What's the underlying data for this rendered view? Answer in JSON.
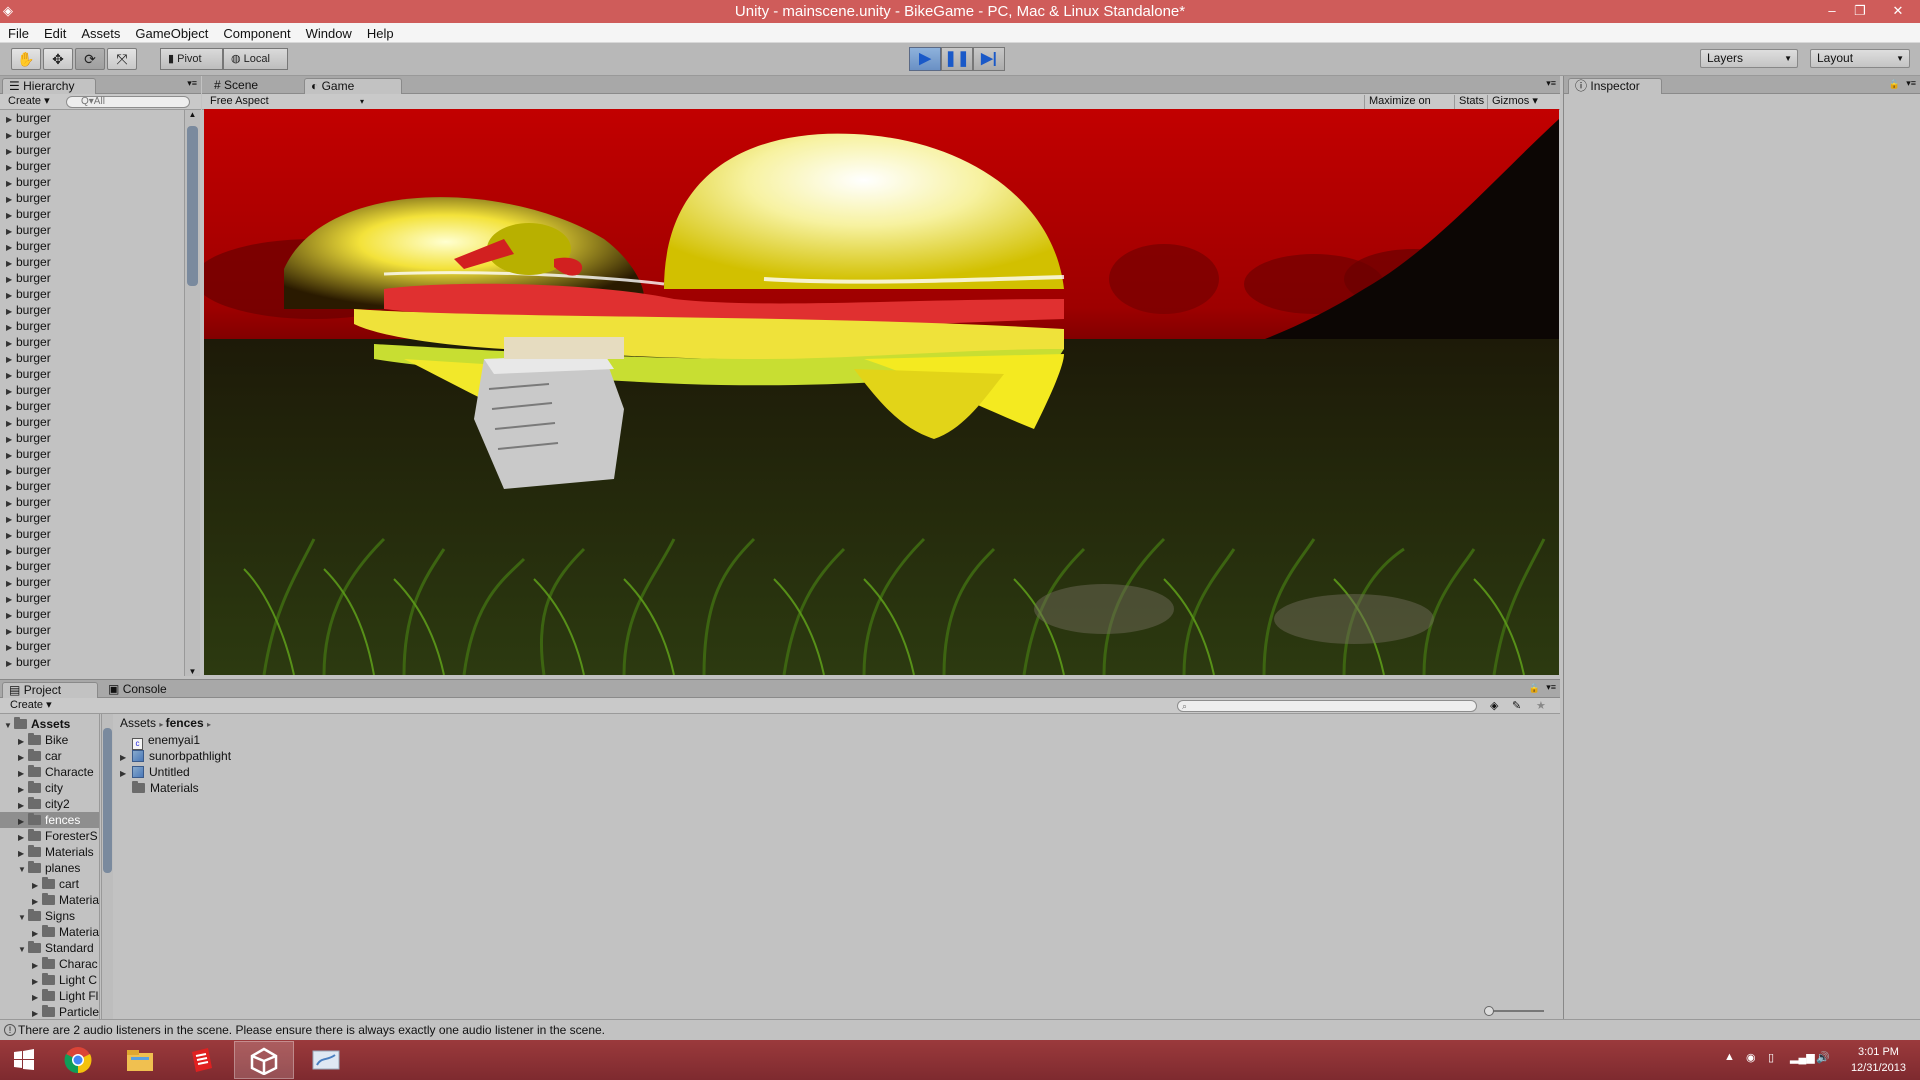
{
  "window": {
    "title": "Unity - mainscene.unity - BikeGame - PC, Mac & Linux Standalone*",
    "app_icon": "unity-icon",
    "controls": [
      "minimize",
      "restore",
      "close"
    ]
  },
  "menu": [
    "File",
    "Edit",
    "Assets",
    "GameObject",
    "Component",
    "Window",
    "Help"
  ],
  "toolbar": {
    "tools": [
      "hand-tool-icon",
      "move-tool-icon",
      "rotate-tool-icon",
      "scale-tool-icon"
    ],
    "pivot_label": "Pivot",
    "local_label": "Local",
    "play_state": "playing",
    "layers_label": "Layers",
    "layout_label": "Layout"
  },
  "hierarchy": {
    "tab_label": "Hierarchy",
    "create_label": "Create",
    "search_placeholder": "Q▾All",
    "items": [
      "burger",
      "burger",
      "burger",
      "burger",
      "burger",
      "burger",
      "burger",
      "burger",
      "burger",
      "burger",
      "burger",
      "burger",
      "burger",
      "burger",
      "burger",
      "burger",
      "burger",
      "burger",
      "burger",
      "burger",
      "burger",
      "burger",
      "burger",
      "burger",
      "burger",
      "burger",
      "burger",
      "burger",
      "burger",
      "burger",
      "burger",
      "burger",
      "burger",
      "burger",
      "burger"
    ]
  },
  "center": {
    "tabs": [
      {
        "label": "Scene"
      },
      {
        "label": "Game"
      }
    ],
    "active_tab": "Game",
    "aspect_label": "Free Aspect",
    "maximize_label": "Maximize on Play",
    "stats_label": "Stats",
    "gizmos_label": "Gizmos"
  },
  "inspector": {
    "tab_label": "Inspector"
  },
  "project": {
    "tabs": [
      {
        "label": "Project"
      },
      {
        "label": "Console"
      }
    ],
    "create_label": "Create",
    "tree": [
      {
        "label": "Assets",
        "indent": 0,
        "expanded": true,
        "bold": true
      },
      {
        "label": "Bike",
        "indent": 1
      },
      {
        "label": "car",
        "indent": 1
      },
      {
        "label": "Characte",
        "indent": 1
      },
      {
        "label": "city",
        "indent": 1
      },
      {
        "label": "city2",
        "indent": 1
      },
      {
        "label": "fences",
        "indent": 1,
        "selected": true
      },
      {
        "label": "ForesterS",
        "indent": 1
      },
      {
        "label": "Materials",
        "indent": 1
      },
      {
        "label": "planes",
        "indent": 1,
        "expanded": true
      },
      {
        "label": "cart",
        "indent": 2
      },
      {
        "label": "Materia",
        "indent": 2
      },
      {
        "label": "Signs",
        "indent": 1,
        "expanded": true
      },
      {
        "label": "Materia",
        "indent": 2
      },
      {
        "label": "Standard",
        "indent": 1,
        "expanded": true
      },
      {
        "label": "Charac",
        "indent": 2
      },
      {
        "label": "Light C",
        "indent": 2
      },
      {
        "label": "Light Fl",
        "indent": 2
      },
      {
        "label": "Particle",
        "indent": 2
      }
    ],
    "breadcrumb": [
      "Assets",
      "fences"
    ],
    "files": [
      {
        "label": "enemyai1",
        "type": "script"
      },
      {
        "label": "sunorbpathlight",
        "type": "prefab"
      },
      {
        "label": "Untitled",
        "type": "prefab"
      },
      {
        "label": "Materials",
        "type": "folder"
      }
    ]
  },
  "status": {
    "message": "There are 2 audio listeners in the scene. Please ensure there is always exactly one audio listener in the scene."
  },
  "taskbar": {
    "apps": [
      "windows-start-icon",
      "chrome-icon",
      "file-explorer-icon",
      "sketchup-icon",
      "unity-icon",
      "paint-icon"
    ],
    "time": "3:01 PM",
    "date": "12/31/2013"
  }
}
